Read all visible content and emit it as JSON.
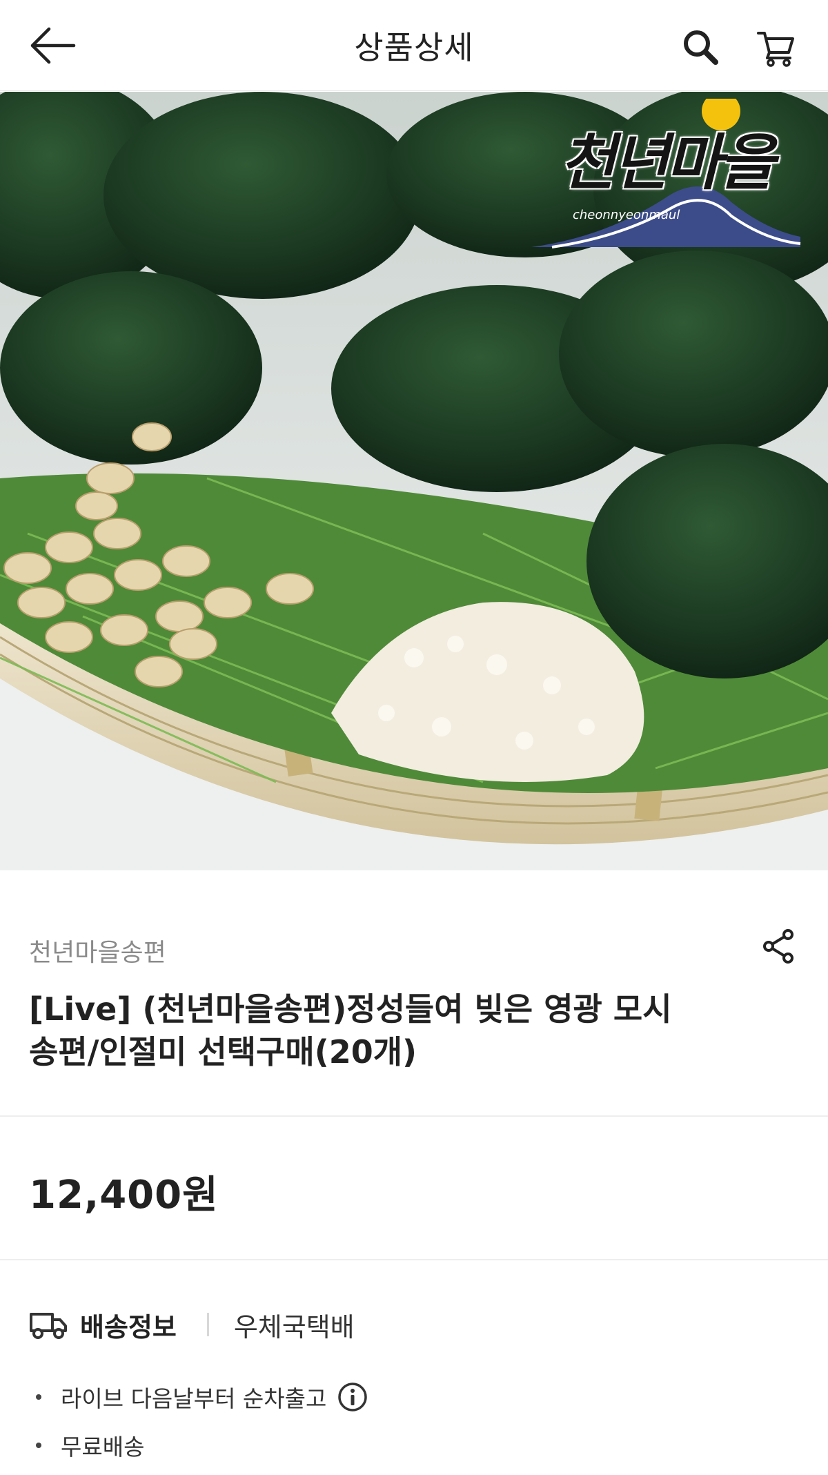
{
  "header": {
    "title": "상품상세",
    "back_icon": "arrow-left-icon",
    "search_icon": "search-icon",
    "cart_icon": "cart-icon"
  },
  "hero": {
    "logo_text": "천년마을",
    "logo_subtext": "cheonnyeonmaul"
  },
  "product": {
    "brand": "천년마을송편",
    "title_line1": "[Live] (천년마을송편)정성들여 빚은 영광 모시",
    "title_line2": "송편/인절미 선택구매(20개)",
    "price": "12,400원"
  },
  "shipping": {
    "label": "배송정보",
    "carrier": "우체국택배",
    "notes": [
      "라이브 다음날부터 순차출고",
      "무료배송"
    ]
  },
  "colors": {
    "songpyeon": "#1f3d24",
    "pine": "#5b9a3c",
    "basket": "#e2d6b4",
    "text_secondary": "#8a8a8a"
  }
}
